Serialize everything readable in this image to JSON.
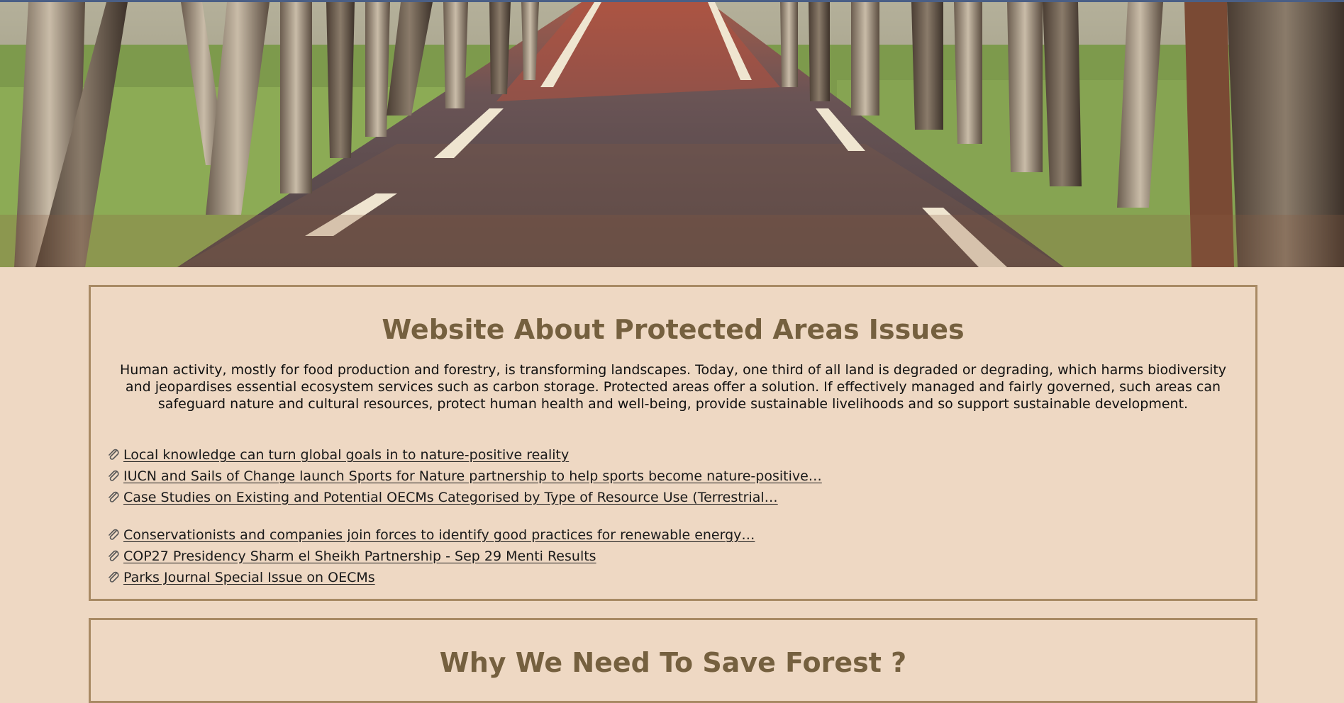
{
  "hero": {
    "image": "tree-lined-road-with-fallen-leaves"
  },
  "section1": {
    "title": "Website About Protected Areas Issues",
    "intro": "Human activity, mostly for food production and forestry, is transforming landscapes. Today, one third of all land is degraded or degrading, which harms biodiversity and jeopardises essential ecosystem services such as carbon storage. Protected areas offer a solution. If effectively managed and fairly governed, such areas can safeguard nature and cultural resources, protect human health and well-being, provide sustainable livelihoods and so support sustainable development.",
    "links_group1": [
      "Local knowledge can turn global goals in to nature-positive reality",
      "IUCN and Sails of Change launch Sports for Nature partnership to help sports become nature-positive…",
      "Case Studies on Existing and Potential OECMs Categorised by Type of Resource Use (Terrestrial…"
    ],
    "links_group2": [
      "Conservationists and companies join forces to identify good practices for renewable energy…",
      "COP27 Presidency Sharm el Sheikh Partnership - Sep 29 Menti Results",
      "Parks Journal Special Issue on OECMs"
    ],
    "link_icon": "paperclip-icon"
  },
  "section2": {
    "title": "Why We Need To Save Forest ?"
  },
  "colors": {
    "page_background": "#eed8c3",
    "box_border": "#a88a64",
    "heading": "#75603f"
  }
}
